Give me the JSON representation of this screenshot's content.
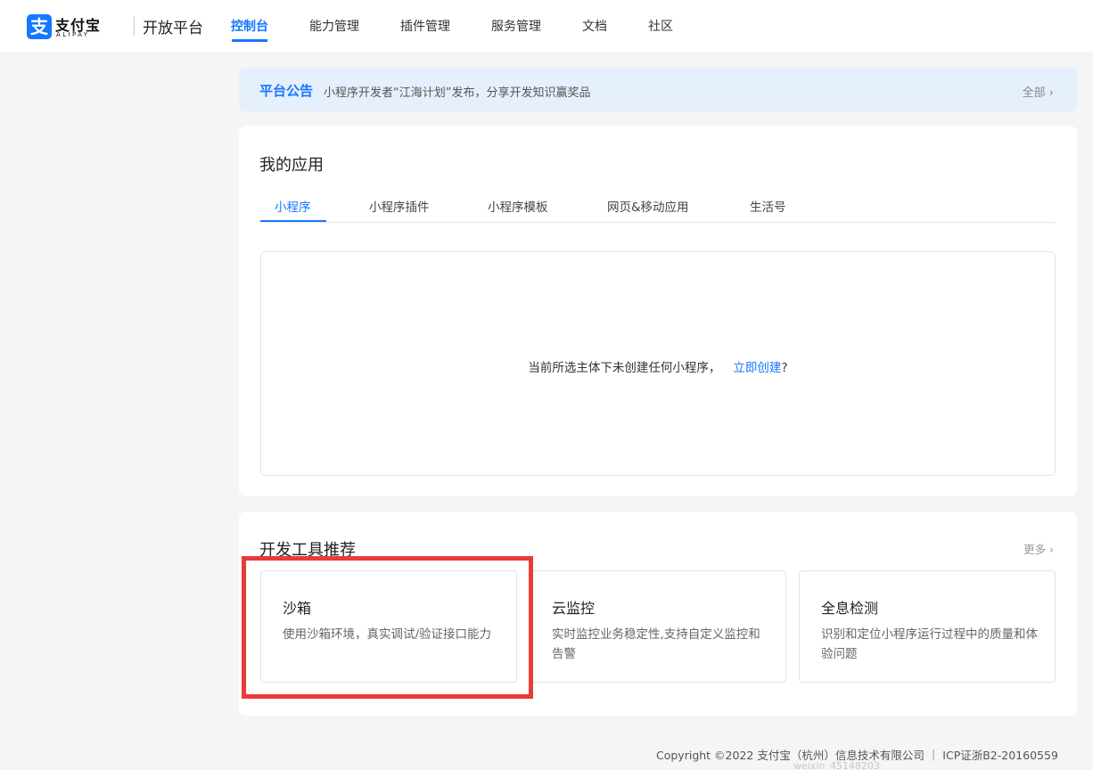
{
  "header": {
    "logo_cn": "支付宝",
    "logo_en": "ALIPAY",
    "platform": "开放平台",
    "nav": [
      {
        "label": "控制台",
        "active": true
      },
      {
        "label": "能力管理"
      },
      {
        "label": "插件管理"
      },
      {
        "label": "服务管理"
      },
      {
        "label": "文档"
      },
      {
        "label": "社区"
      }
    ]
  },
  "announcement": {
    "tag": "平台公告",
    "text": "小程序开发者“江海计划”发布，分享开发知识赢奖品",
    "all_label": "全部 ›"
  },
  "my_apps": {
    "title": "我的应用",
    "tabs": [
      "小程序",
      "小程序插件",
      "小程序模板",
      "网页&移动应用",
      "生活号"
    ],
    "active_tab": "小程序",
    "empty_text": "当前所选主体下未创建任何小程序，",
    "create_link": "立即创建",
    "question_mark": "?"
  },
  "dev_tools": {
    "title": "开发工具推荐",
    "more_label": "更多 ›",
    "tools": [
      {
        "name": "沙箱",
        "desc": "使用沙箱环境，真实调试/验证接口能力"
      },
      {
        "name": "云监控",
        "desc": "实时监控业务稳定性,支持自定义监控和告警"
      },
      {
        "name": "全息检测",
        "desc": "识别和定位小程序运行过程中的质量和体验问题"
      }
    ]
  },
  "footer": {
    "copyright": "Copyright ©2022 支付宝（杭州）信息技术有限公司 ｜ ICP证浙B2-20160559",
    "watermark": "weixin_45148203"
  },
  "colors": {
    "accent": "#1677ff",
    "highlight": "#ea3b3b",
    "background": "#f5f5f5"
  }
}
